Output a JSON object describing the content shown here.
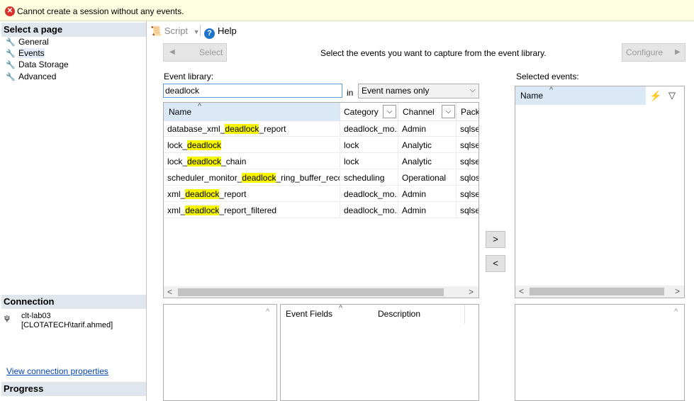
{
  "error": {
    "icon": "error-circle-icon",
    "message": "Cannot create a session without any events."
  },
  "left_pane": {
    "select_page_title": "Select a page",
    "pages": [
      {
        "label": "General"
      },
      {
        "label": "Events"
      },
      {
        "label": "Data Storage"
      },
      {
        "label": "Advanced"
      }
    ],
    "connection_title": "Connection",
    "connection_server": "clt-lab03",
    "connection_user": "[CLOTATECH\\tarif.ahmed]",
    "view_connection_link": "View connection properties",
    "progress_title": "Progress"
  },
  "toolbar": {
    "script_label": "Script",
    "help_label": "Help"
  },
  "actions": {
    "select_label": "Select",
    "instruction": "Select the events you want to capture from the event library.",
    "configure_label": "Configure"
  },
  "library": {
    "label": "Event library:",
    "search_value": "deadlock",
    "in_label": "in",
    "scope_value": "Event names only",
    "columns": {
      "name": "Name",
      "category": "Category",
      "channel": "Channel",
      "package": "Pack"
    },
    "rows": [
      {
        "name_pre": "database_xml_",
        "name_hl": "deadlock",
        "name_post": "_report",
        "category": "deadlock_mo...",
        "channel": "Admin",
        "package": "sqlse"
      },
      {
        "name_pre": "lock_",
        "name_hl": "deadlock",
        "name_post": "",
        "category": "lock",
        "channel": "Analytic",
        "package": "sqlse"
      },
      {
        "name_pre": "lock_",
        "name_hl": "deadlock",
        "name_post": "_chain",
        "category": "lock",
        "channel": "Analytic",
        "package": "sqlse"
      },
      {
        "name_pre": "scheduler_monitor_",
        "name_hl": "deadlock",
        "name_post": "_ring_buffer_recor...",
        "category": "scheduling",
        "channel": "Operational",
        "package": "sqlos"
      },
      {
        "name_pre": "xml_",
        "name_hl": "deadlock",
        "name_post": "_report",
        "category": "deadlock_mo...",
        "channel": "Admin",
        "package": "sqlse"
      },
      {
        "name_pre": "xml_",
        "name_hl": "deadlock",
        "name_post": "_report_filtered",
        "category": "deadlock_mo...",
        "channel": "Admin",
        "package": "sqlse"
      }
    ]
  },
  "selected_events": {
    "label": "Selected events:",
    "name_header": "Name"
  },
  "event_fields": {
    "fields_header": "Event Fields",
    "description_header": "Description"
  },
  "colors": {
    "highlight": "#f5f500",
    "header_selected": "#dbe9f6",
    "section_header": "#dfe6ee",
    "error_bg": "#ffffe1"
  }
}
